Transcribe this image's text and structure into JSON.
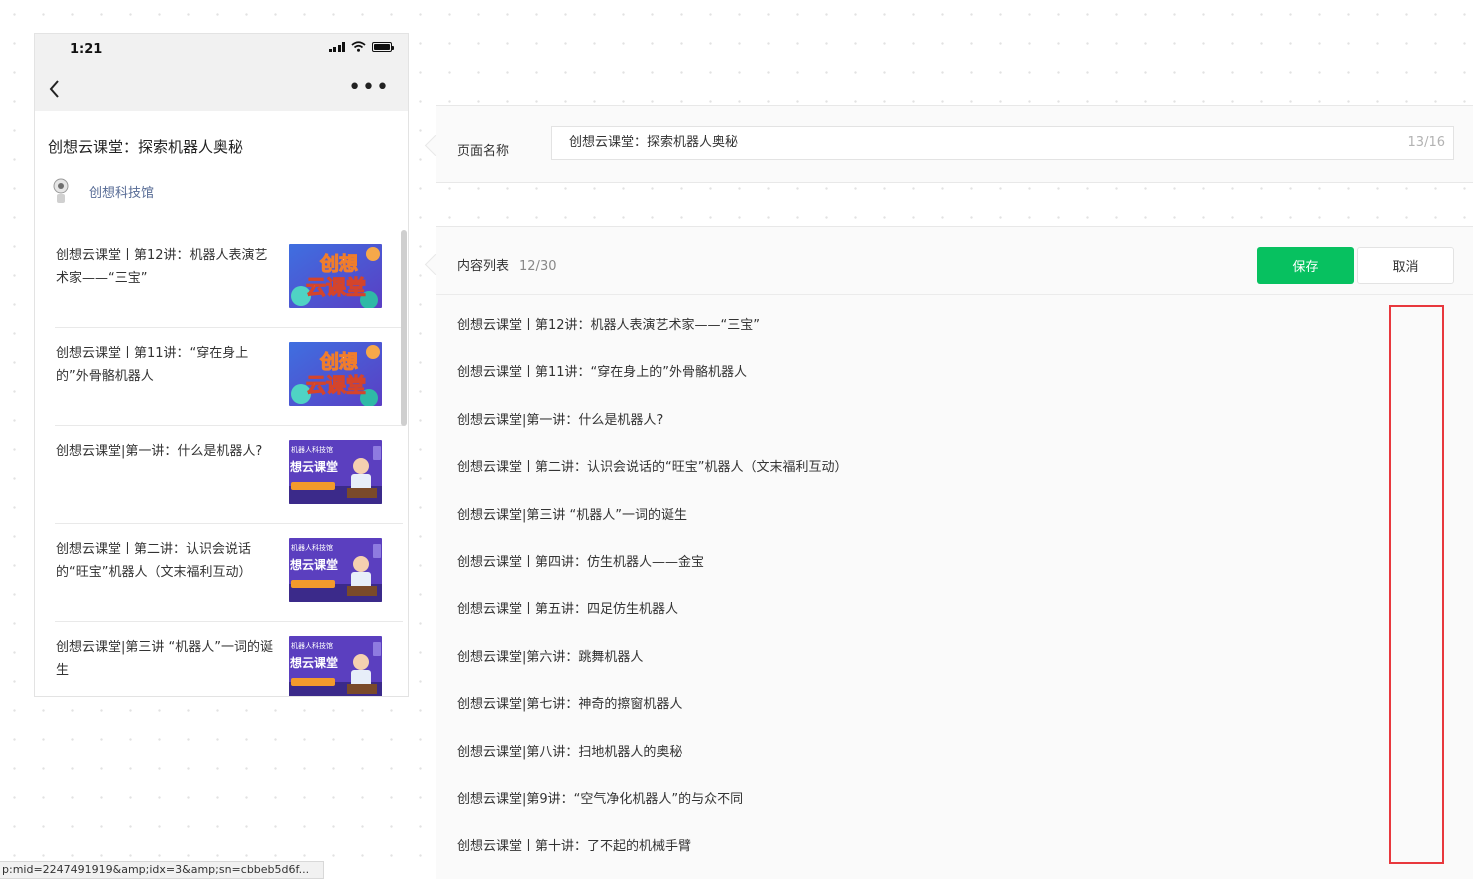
{
  "phone": {
    "status_time": "1:21",
    "article_title": "创想云课堂：探索机器人奥秘",
    "author_name": "创想科技馆",
    "items": [
      {
        "title": "创想云课堂丨第12讲：机器人表演艺术家——“三宝”",
        "thumb": "card-a"
      },
      {
        "title": "创想云课堂丨第11讲：“穿在身上的”外骨骼机器人",
        "thumb": "card-a"
      },
      {
        "title": "创想云课堂|第一讲：什么是机器人?",
        "thumb": "card-b"
      },
      {
        "title": "创想云课堂丨第二讲：认识会说话的“旺宝”机器人（文末福利互动）",
        "thumb": "card-b"
      },
      {
        "title": "创想云课堂|第三讲 “机器人”一词的诞生",
        "thumb": "card-b"
      }
    ],
    "thumb_text": {
      "card_a_line1": "创想",
      "card_a_line2": "云课堂",
      "card_b_line1": "机器人科技馆",
      "card_b_line2": "想云课堂"
    }
  },
  "editor": {
    "name_label": "页面名称",
    "name_value": "创想云课堂：探索机器人奥秘",
    "name_count": "13/16",
    "content_label": "内容列表",
    "content_count": "12/30",
    "save_label": "保存",
    "cancel_label": "取消",
    "content_items": [
      "创想云课堂丨第12讲：机器人表演艺术家——“三宝”",
      "创想云课堂丨第11讲：“穿在身上的”外骨骼机器人",
      "创想云课堂|第一讲：什么是机器人?",
      "创想云课堂丨第二讲：认识会说话的“旺宝”机器人（文末福利互动）",
      "创想云课堂|第三讲 “机器人”一词的诞生",
      "创想云课堂丨第四讲：仿生机器人——金宝",
      "创想云课堂丨第五讲：四足仿生机器人",
      "创想云课堂|第六讲：跳舞机器人",
      "创想云课堂|第七讲：神奇的擦窗机器人",
      "创想云课堂|第八讲：扫地机器人的奥秘",
      "创想云课堂|第9讲：“空气净化机器人”的与众不同",
      "创想云课堂丨第十讲：了不起的机械手臂"
    ]
  },
  "status_url": "p:mid=2247491919&amp;idx=3&amp;sn=cbbeb5d6f...",
  "colors": {
    "accent_green": "#07c160",
    "link_blue": "#576b95",
    "highlight_red": "#e8383d"
  },
  "icons": [
    "back-chevron-icon",
    "more-dots-icon",
    "signal-icon",
    "wifi-icon",
    "battery-icon",
    "avatar-icon"
  ]
}
